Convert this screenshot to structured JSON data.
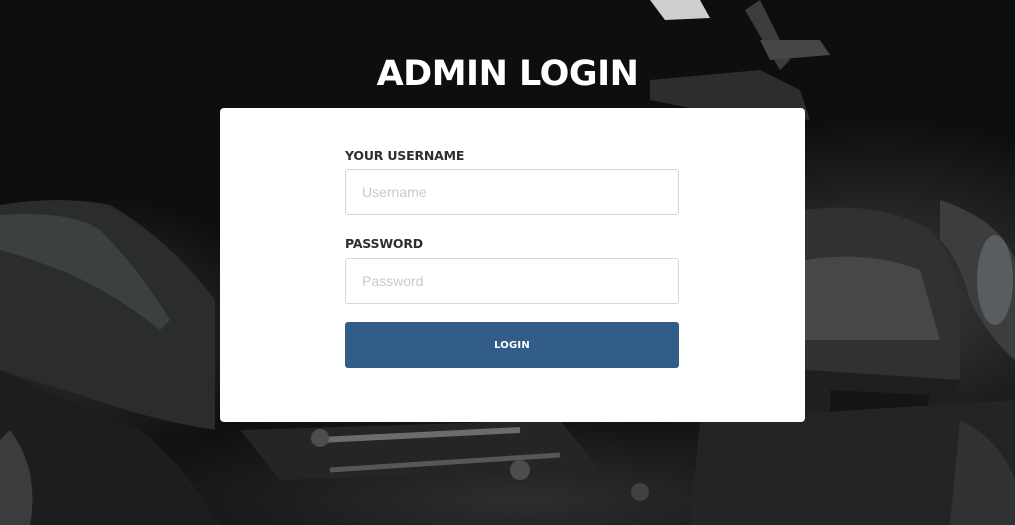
{
  "page": {
    "title": "ADMIN LOGIN",
    "accent_color": "#325d89"
  },
  "form": {
    "username": {
      "label": "YOUR USERNAME",
      "placeholder": "Username",
      "value": ""
    },
    "password": {
      "label": "PASSWORD",
      "placeholder": "Password",
      "value": ""
    },
    "submit_label": "LOGIN"
  }
}
